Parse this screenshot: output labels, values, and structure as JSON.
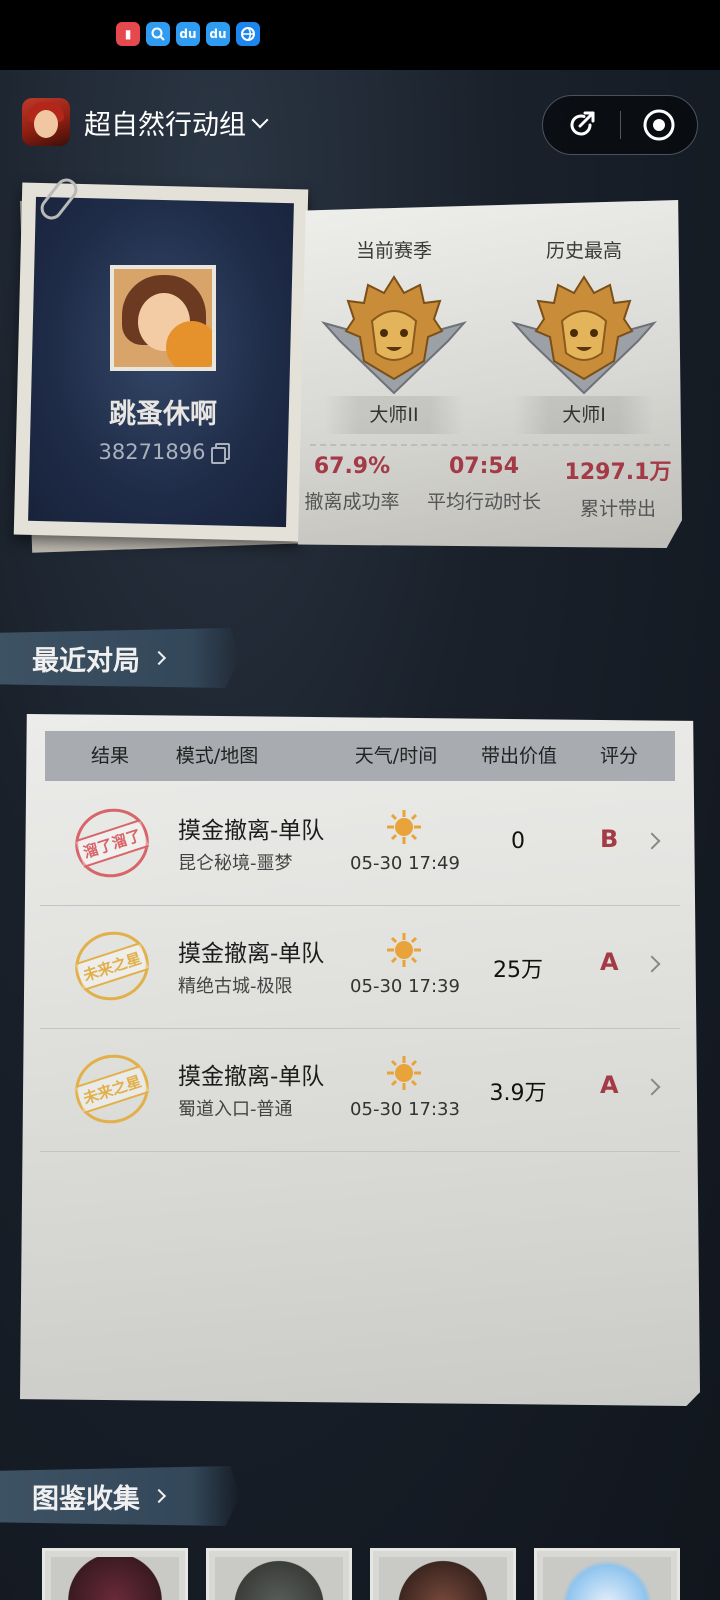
{
  "header": {
    "group_name": "超自然行动组"
  },
  "profile": {
    "name": "跳蚤休啊",
    "id": "38271896"
  },
  "ranks": {
    "current_label": "当前赛季",
    "current_rank": "大师II",
    "best_label": "历史最高",
    "best_rank": "大师I"
  },
  "stats": [
    {
      "value": "67.9%",
      "label": "撤离成功率"
    },
    {
      "value": "07:54",
      "label": "平均行动时长"
    },
    {
      "value": "1297.1万",
      "label": "累计带出"
    }
  ],
  "recent": {
    "title": "最近对局",
    "columns": [
      "结果",
      "模式/地图",
      "天气/时间",
      "带出价值",
      "评分"
    ],
    "matches": [
      {
        "stamp": "溜了溜了",
        "stamp_color": "#d7656a",
        "mode": "摸金撤离-单队",
        "map": "昆仑秘境-噩梦",
        "time": "05-30 17:49",
        "value": "0",
        "grade": "B"
      },
      {
        "stamp": "未来之星",
        "stamp_color": "#e2b04a",
        "mode": "摸金撤离-单队",
        "map": "精绝古城-极限",
        "time": "05-30 17:39",
        "value": "25万",
        "grade": "A"
      },
      {
        "stamp": "未来之星",
        "stamp_color": "#e2b04a",
        "mode": "摸金撤离-单队",
        "map": "蜀道入口-普通",
        "time": "05-30 17:33",
        "value": "3.9万",
        "grade": "A"
      }
    ]
  },
  "collection": {
    "title": "图鉴收集"
  },
  "colors": {
    "accent_red": "#a33a46",
    "sun": "#e8a33a"
  }
}
